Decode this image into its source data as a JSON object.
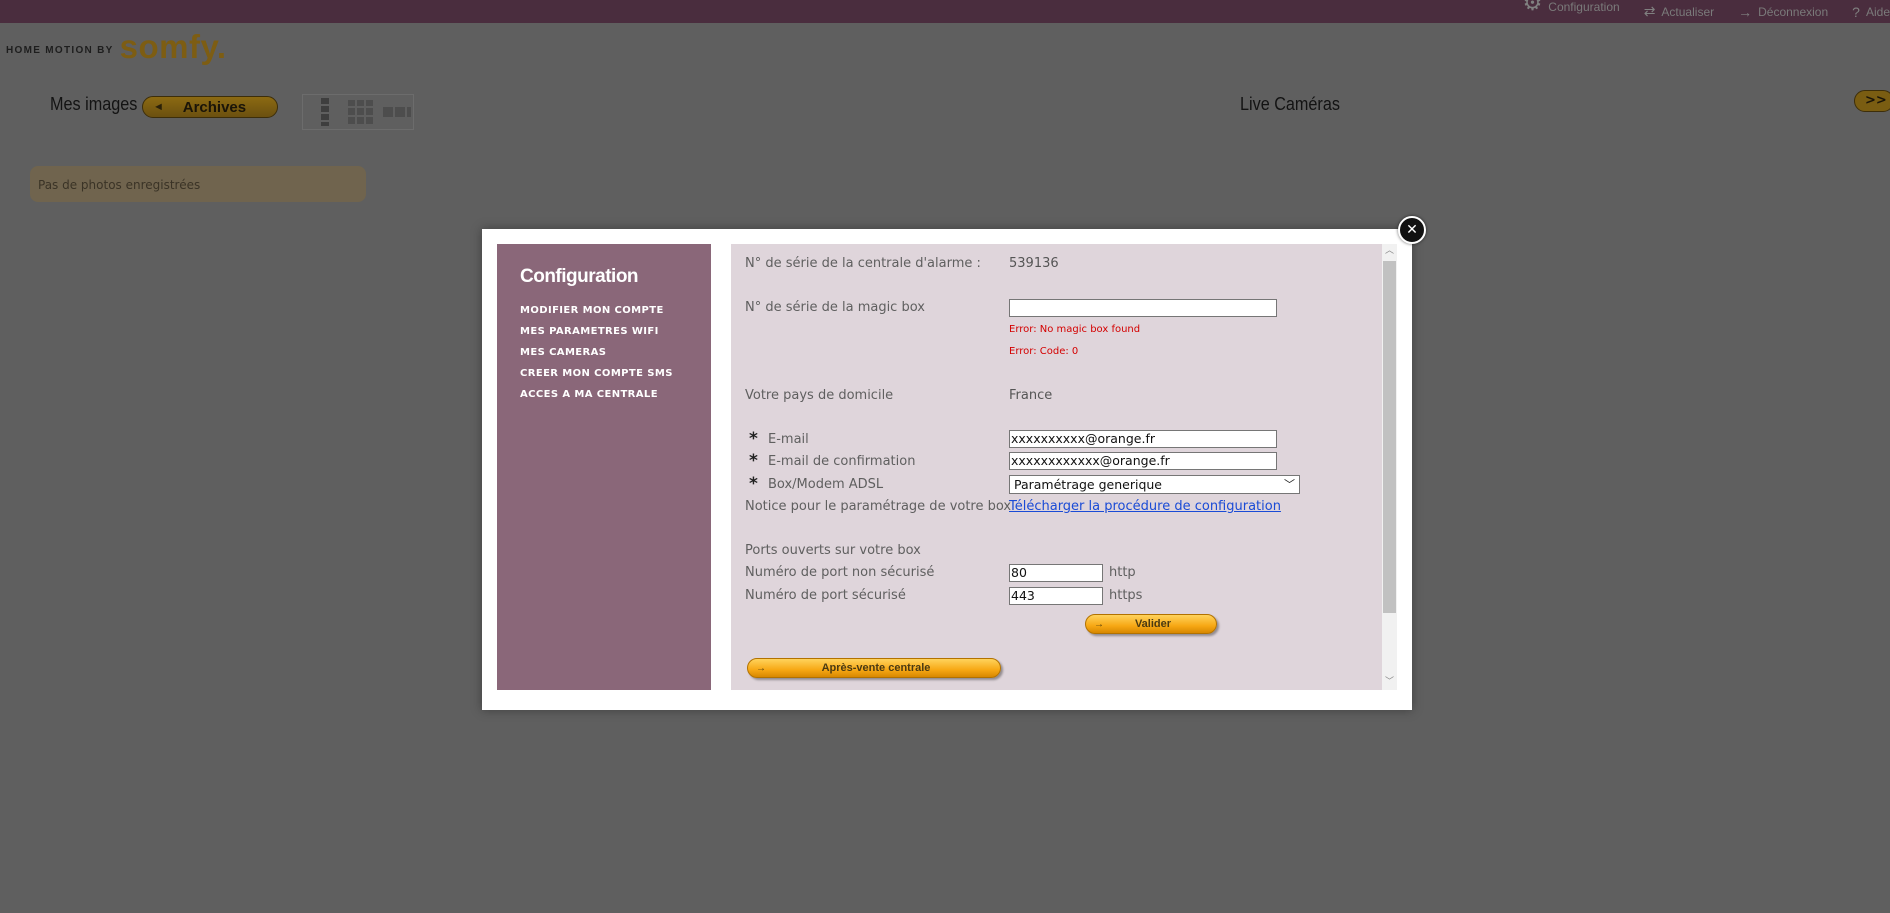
{
  "topbar": {
    "links": [
      {
        "icon": "gear-icon",
        "glyph": "⚙",
        "label": "Configuration"
      },
      {
        "icon": "refresh-icon",
        "glyph": "⇄",
        "label": "Actualiser"
      },
      {
        "icon": "logout-icon",
        "glyph": "→",
        "label": "Déconnexion"
      },
      {
        "icon": "help-icon",
        "glyph": "?",
        "label": "Aide"
      }
    ]
  },
  "brand": {
    "tagline": "HOME MOTION BY",
    "logo": "somfy."
  },
  "gallery": {
    "title": "Mes images",
    "archives_label": "Archives",
    "empty_message": "Pas de photos enregistrées"
  },
  "live": {
    "title": "Live Caméras",
    "next_label": ">>"
  },
  "modal": {
    "close_glyph": "✕",
    "sidebar": {
      "title": "Configuration",
      "items": [
        "MODIFIER MON COMPTE",
        "MES PARAMETRES WIFI",
        "MES CAMERAS",
        "CREER MON COMPTE SMS",
        "ACCES A MA CENTRALE"
      ]
    },
    "form": {
      "alarm_serial_label": "N° de série de la centrale d'alarme :",
      "alarm_serial_value": "539136",
      "magic_box_label": "N° de série de la magic box",
      "magic_box_value": "",
      "error_1": "Error: No magic box found",
      "error_2": "Error: Code: 0",
      "country_label": "Votre pays de domicile",
      "country_value": "France",
      "required_mark": "*",
      "email_label": "E-mail",
      "email_value": "xxxxxxxxxx@orange.fr",
      "email_confirm_label": "E-mail de confirmation",
      "email_confirm_value": "xxxxxxxxxxxx@orange.fr",
      "box_label": "Box/Modem ADSL",
      "box_value": "Paramétrage generique",
      "notice_label": "Notice pour le paramétrage de votre box",
      "notice_link": "Télécharger la procédure de configuration",
      "ports_heading": "Ports ouverts sur votre box",
      "port_http_label": "Numéro de port non sécurisé",
      "port_http_value": "80",
      "port_http_unit": "http",
      "port_https_label": "Numéro de port sécurisé",
      "port_https_value": "443",
      "port_https_unit": "https",
      "validate_label": "Valider",
      "after_sales_label": "Après-vente centrale"
    }
  }
}
